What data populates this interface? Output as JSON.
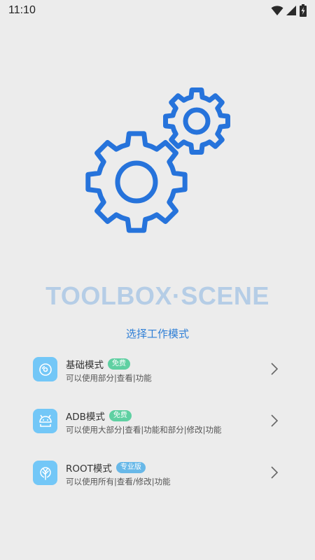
{
  "status_bar": {
    "time": "11:10",
    "icons": [
      "wifi-icon",
      "signal-icon",
      "battery-charging-icon"
    ]
  },
  "hero": {
    "icon": "gears-icon",
    "accent_color": "#2673db",
    "title": "TOOLBOX·SCENE",
    "title_color": "#b5cde6"
  },
  "modes": {
    "heading": "选择工作模式",
    "items": [
      {
        "title": "基础模式",
        "badge": "免费",
        "description": "可以使用部分|查看|功能",
        "icon": "disc-icon"
      },
      {
        "title": "ADB模式",
        "badge": "免费",
        "description": "可以使用大部分|查看|功能和部分|修改|功能",
        "icon": "android-icon"
      },
      {
        "title": "ROOT模式",
        "badge": "专业版",
        "description": "可以使用所有|查看/修改|功能",
        "icon": "tree-icon"
      }
    ]
  }
}
